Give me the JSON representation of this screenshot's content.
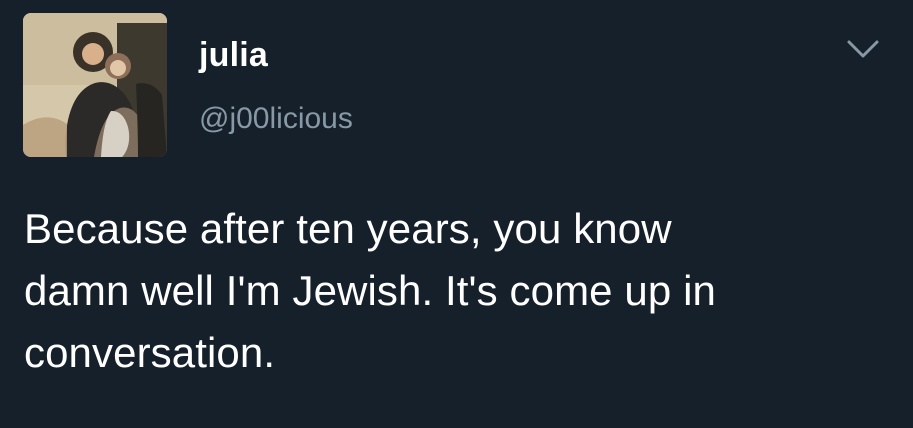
{
  "tweet": {
    "avatar_icon": "profile-photo",
    "display_name": "julia",
    "handle": "@j00licious",
    "menu_icon": "chevron-down-icon",
    "text": "Because after ten years, you know\ndamn well I'm Jewish. It's come up in\nconversation."
  },
  "colors": {
    "background": "#15202b",
    "primary_text": "#ffffff",
    "secondary_text": "#8899a6"
  }
}
